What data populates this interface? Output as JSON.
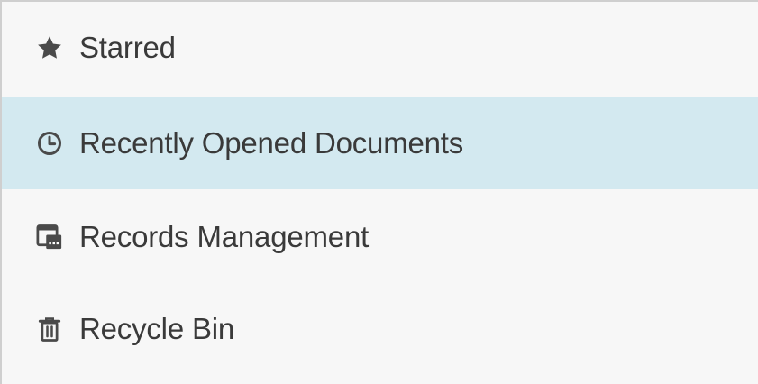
{
  "nav": {
    "items": [
      {
        "label": "Starred",
        "icon": "star-icon"
      },
      {
        "label": "Recently Opened Documents",
        "icon": "clock-icon",
        "active": true
      },
      {
        "label": "Records Management",
        "icon": "records-management-icon"
      },
      {
        "label": "Recycle Bin",
        "icon": "trash-icon"
      }
    ]
  },
  "colors": {
    "panel_background": "#f7f7f7",
    "active_background": "#d3e9f0",
    "text": "#3a3a3a",
    "icon": "#4a4a4a",
    "border": "#cfcfcf"
  }
}
